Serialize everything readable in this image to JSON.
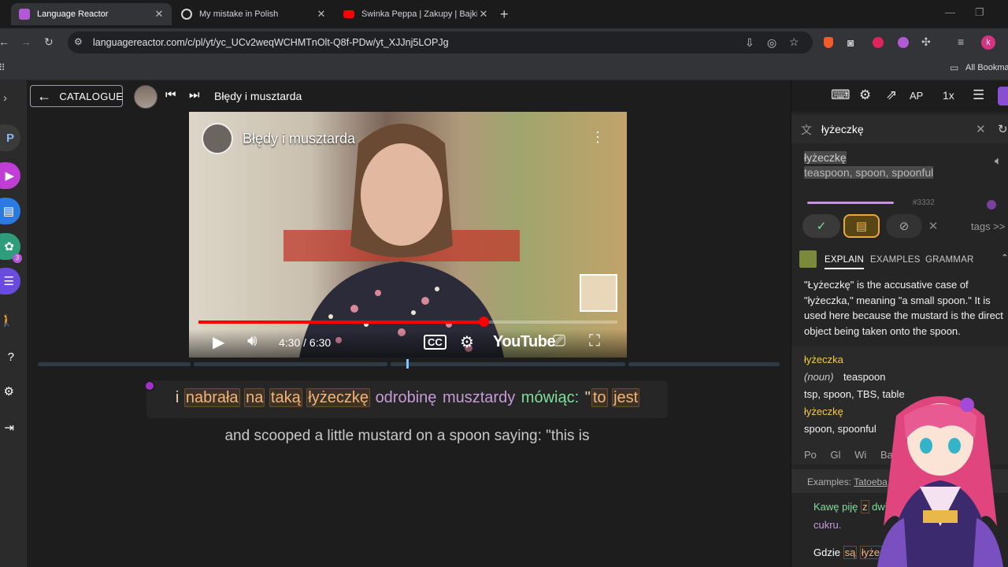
{
  "browser": {
    "tabs": [
      {
        "title": "Language Reactor",
        "icon_color": "#b25ad6",
        "active": true
      },
      {
        "title": "My mistake in Polish",
        "icon_color": "#d5d5d5",
        "active": false
      },
      {
        "title": "Świnka Peppa | Zakupy | Bajki P",
        "icon_color": "#ff0000",
        "active": false
      }
    ],
    "url": "languagereactor.com/c/pl/yt/yc_UCv2weqWCHMTnOlt-Q8f-PDw/yt_XJJnj5LOPJg",
    "bookmarks_label": "All Bookmar",
    "profile_initial": "k"
  },
  "app": {
    "catalogue_label": "CATALOGUE",
    "video_title": "Błędy i musztarda",
    "speed_label": "1x",
    "ap_label": "AP",
    "left_p": "P",
    "badge_count": "3"
  },
  "video": {
    "title": "Błędy i musztarda",
    "time": "4:30 / 6:30",
    "progress": 0.68,
    "logo": "YouTube"
  },
  "subtitle": {
    "words": [
      {
        "text": "i",
        "style": "plain"
      },
      {
        "text": "nabrała",
        "style": "known"
      },
      {
        "text": "na",
        "style": "known"
      },
      {
        "text": "taką",
        "style": "known"
      },
      {
        "text": "łyżeczkę",
        "style": "known"
      },
      {
        "text": "odrobinę",
        "style": "learn"
      },
      {
        "text": "musztardy",
        "style": "learn"
      },
      {
        "text": "mówiąc:",
        "style": "green"
      },
      {
        "text": "\"",
        "style": "plain"
      },
      {
        "text": "to",
        "style": "known"
      },
      {
        "text": "jest",
        "style": "known"
      }
    ],
    "translation": "and scooped a little mustard on a spoon saying: \"this is"
  },
  "panel": {
    "search_value": "łyżeczkę",
    "word": "łyżeczkę",
    "definition": "teaspoon, spoon, spoonful",
    "freq": "#3332",
    "tags_label": "tags >>",
    "tabs": [
      "EXPLAIN",
      "EXAMPLES",
      "GRAMMAR"
    ],
    "explanation": "\"Łyżeczkę\" is the accusative case of \"łyżeczka,\" meaning \"a small spoon.\" It is used here because the mustard is the direct object being taken onto the spoon.",
    "dict_word1": "łyżeczka",
    "dict_pos": "(noun)",
    "dict_pos_meaning": "teaspoon",
    "dict_synonyms": "tsp, spoon, TBS, table",
    "dict_word2": "łyżeczkę",
    "dict_meaning2": "spoon, spoonful",
    "external_links": [
      "Po",
      "Gl",
      "Wi",
      "Ba"
    ],
    "examples_label": "Examples:",
    "examples_source": "Tatoeba",
    "example1_a": "Kawę piję",
    "example1_b": "z",
    "example1_c": "dwier",
    "example1_d": "cukru.",
    "example2_a": "Gdzie",
    "example2_b": "są",
    "example2_c": "łyżec"
  },
  "colors": {
    "accent": "#b25ad6",
    "known_border": "#6b4d2e",
    "learning": "#c69bd8",
    "green": "#7ee09a"
  }
}
